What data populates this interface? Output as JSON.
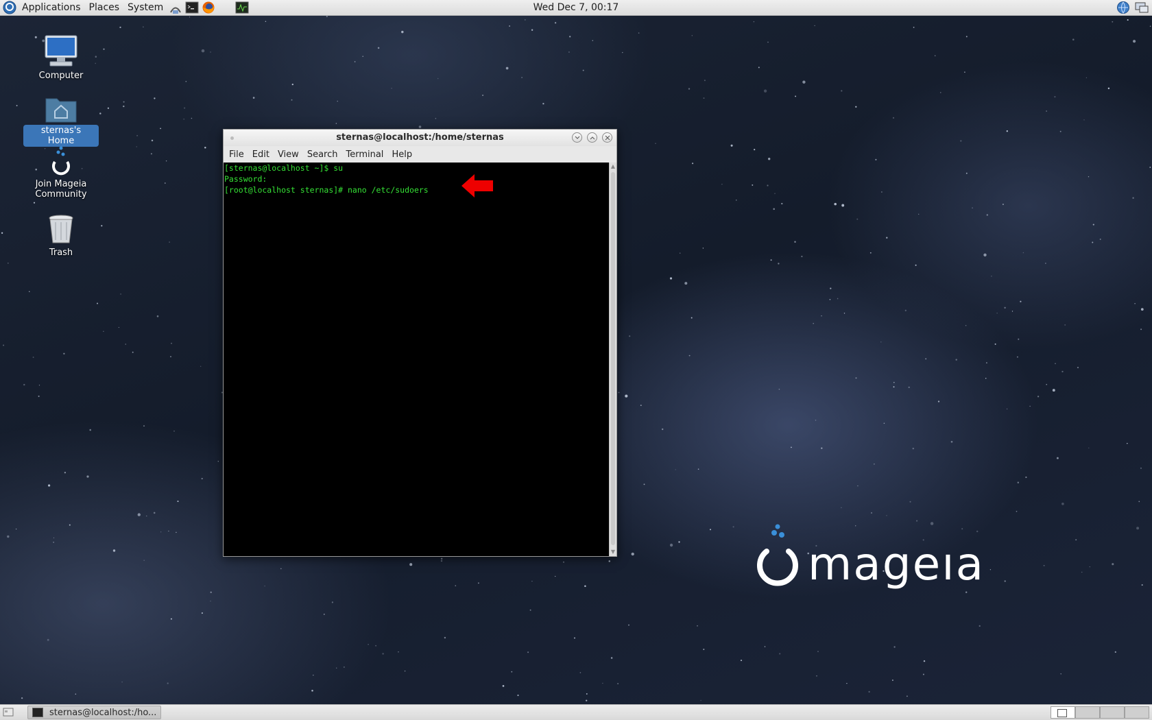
{
  "top_panel": {
    "menus": [
      "Applications",
      "Places",
      "System"
    ],
    "launchers": [
      "network-manager-icon",
      "terminal-icon",
      "firefox-icon",
      "system-monitor-icon"
    ],
    "clock": "Wed Dec  7, 00:17"
  },
  "desktop": {
    "icons": [
      {
        "label": "Computer",
        "icon": "computer-icon"
      },
      {
        "label": "sternas's Home",
        "icon": "home-folder-icon",
        "selected": true
      },
      {
        "label": "Join Mageia Community",
        "icon": "mageia-logo-icon"
      },
      {
        "label": "Trash",
        "icon": "trash-icon"
      }
    ]
  },
  "terminal": {
    "title": "sternas@localhost:/home/sternas",
    "menu": [
      "File",
      "Edit",
      "View",
      "Search",
      "Terminal",
      "Help"
    ],
    "lines": [
      "[sternas@localhost ~]$ su",
      "Password:",
      "[root@localhost sternas]# nano /etc/sudoers"
    ],
    "text_color": "#35e135",
    "annotation_arrow_color": "#ee0000"
  },
  "logo": {
    "text": "mageıa",
    "dot_color": "#3a8fd8"
  },
  "bottom_panel": {
    "task_label": "sternas@localhost:/ho...",
    "workspaces": 4,
    "active_workspace": 1
  }
}
